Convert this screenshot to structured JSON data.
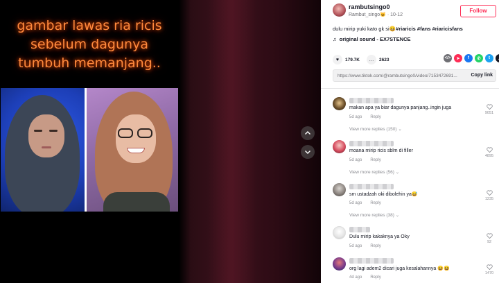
{
  "video": {
    "caption_lines": [
      "gambar lawas ria ricis",
      "sebelum dagunya",
      "tumbuh memanjang.."
    ]
  },
  "nav": {
    "up_icon": "chevron-up-icon",
    "down_icon": "chevron-down-icon"
  },
  "author": {
    "username": "rambutsingo0",
    "display_name": "Rambut_singo😺",
    "date": "10-12",
    "follow_label": "Follow"
  },
  "post": {
    "description_prefix": "dulu mirip yuki kato gk si😆",
    "hashtags": "#riaricis #fans #riaricisfans",
    "sound": "original sound - EX7STENCE",
    "sound_icon": "music-note-icon",
    "likes": "179.7K",
    "comments": "2623",
    "link": "https://www.tiktok.com/@rambutsingo0/video/7153472691...",
    "copy_link_label": "Copy link"
  },
  "share_icons": [
    {
      "name": "embed-icon",
      "glyph": "</>",
      "color": "#6f6f74"
    },
    {
      "name": "send-icon",
      "glyph": "➤",
      "color": "#fe2c55"
    },
    {
      "name": "facebook-icon",
      "glyph": "f",
      "color": "#1877f2"
    },
    {
      "name": "whatsapp-icon",
      "glyph": "✆",
      "color": "#25d366"
    },
    {
      "name": "twitter-icon",
      "glyph": "t",
      "color": "#1da1f2"
    },
    {
      "name": "share-arrow-icon",
      "glyph": "↗",
      "color": "#161823"
    }
  ],
  "comments": [
    {
      "text": "makan apa ya biar dagunya panjang..ingin juga",
      "age": "5d ago",
      "reply": "Reply",
      "likes": "9051",
      "more": "View more replies (150)"
    },
    {
      "text": "moana mirip ricis sblm di filler",
      "age": "5d ago",
      "reply": "Reply",
      "likes": "4895",
      "more": "View more replies (56)"
    },
    {
      "text": "sm ustadzah oki dibolehin ya😅",
      "age": "5d ago",
      "reply": "Reply",
      "likes": "1235",
      "more": "View more replies (38)"
    },
    {
      "text": "Dulu mirip kakaknya ya Oky",
      "age": "5d ago",
      "reply": "Reply",
      "likes": "92",
      "more": ""
    },
    {
      "text": "org lagi adem2 dicari juga kesalahannya 😆😆",
      "age": "4d ago",
      "reply": "Reply",
      "likes": "1470",
      "more": ""
    }
  ]
}
